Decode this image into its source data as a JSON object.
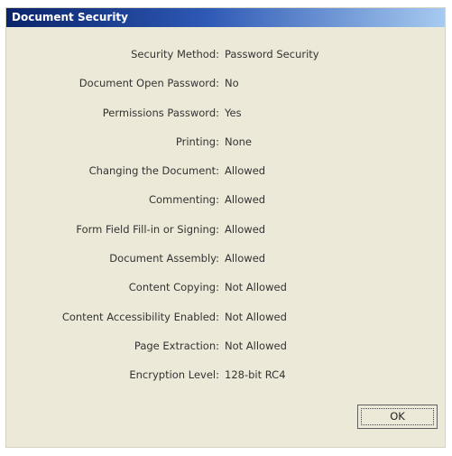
{
  "dialog": {
    "title": "Document Security",
    "rows": [
      {
        "label": "Security Method:",
        "value": "Password Security"
      },
      {
        "label": "Document Open Password:",
        "value": "No"
      },
      {
        "label": "Permissions Password:",
        "value": "Yes"
      },
      {
        "label": "Printing:",
        "value": "None"
      },
      {
        "label": "Changing the Document:",
        "value": "Allowed"
      },
      {
        "label": "Commenting:",
        "value": "Allowed"
      },
      {
        "label": "Form Field Fill-in or Signing:",
        "value": "Allowed"
      },
      {
        "label": "Document Assembly:",
        "value": "Allowed"
      },
      {
        "label": "Content Copying:",
        "value": "Not Allowed"
      },
      {
        "label": "Content Accessibility Enabled:",
        "value": "Not Allowed"
      },
      {
        "label": "Page Extraction:",
        "value": "Not Allowed"
      },
      {
        "label": "Encryption Level:",
        "value": "128-bit RC4"
      }
    ],
    "ok_label": "OK"
  }
}
